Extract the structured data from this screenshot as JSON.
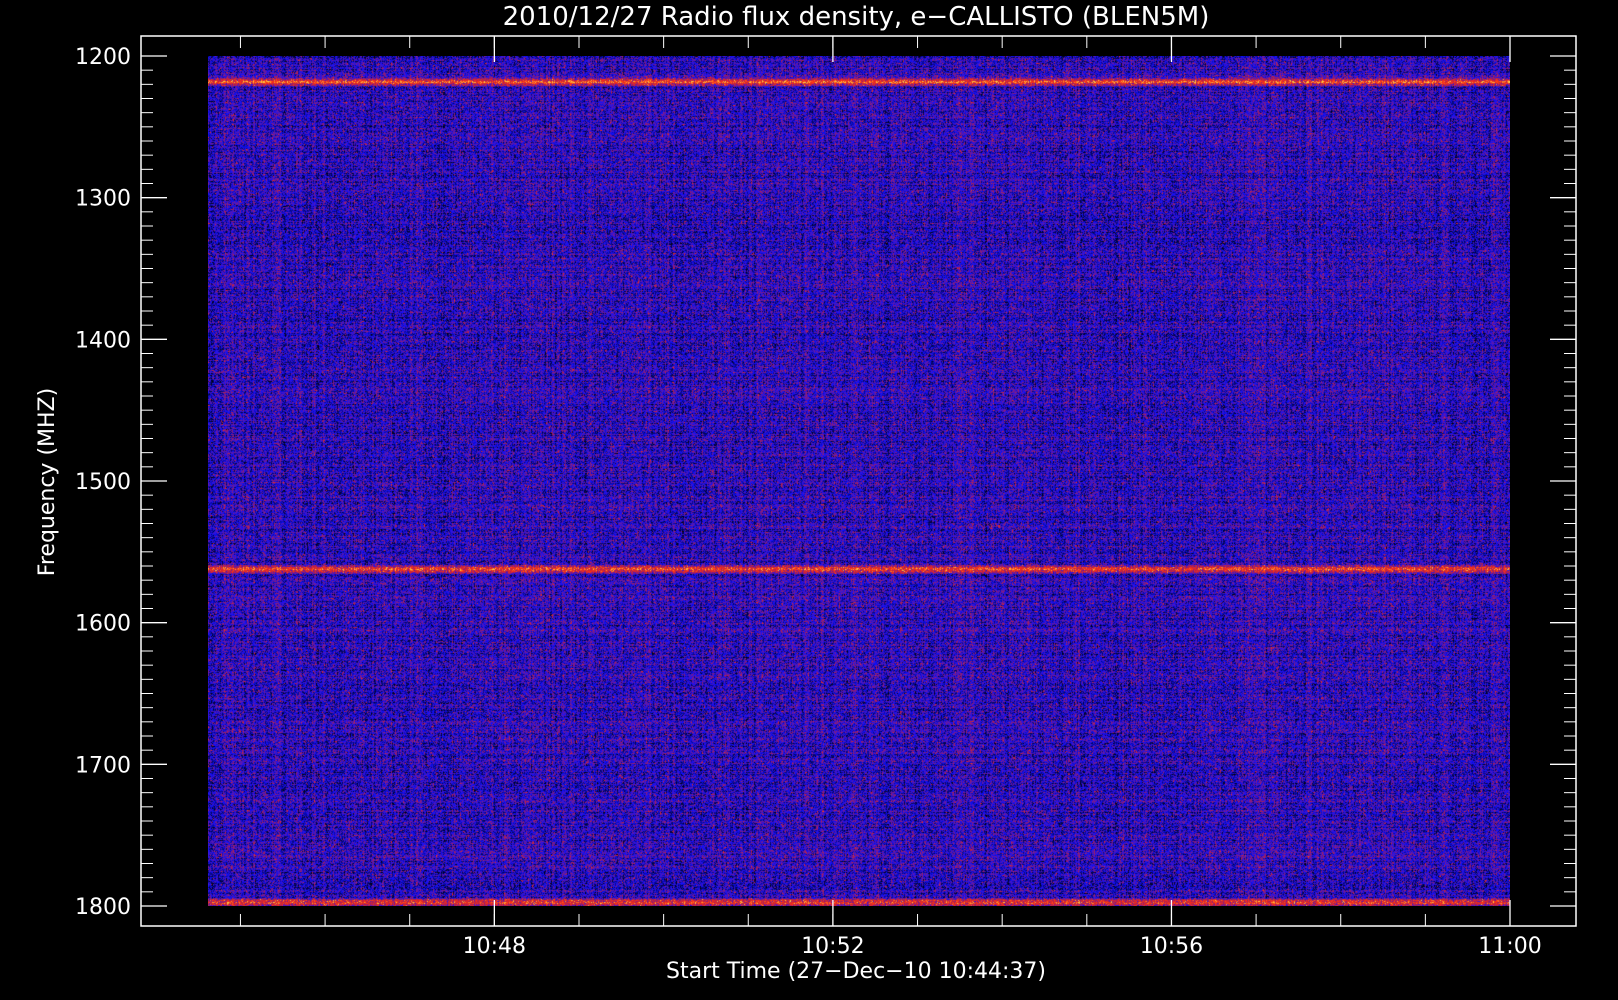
{
  "chart_data": {
    "type": "heatmap",
    "title": "2010/12/27  Radio flux density, e−CALLISTO (BLEN5M)",
    "xlabel": "Start Time (27−Dec−10 10:44:37)",
    "ylabel": "Frequency (MHZ)",
    "x_start": "10:44:37",
    "x_end": "11:00:00",
    "xlim": [
      "10:44:37",
      "11:00:00"
    ],
    "ylim": [
      1200,
      1800
    ],
    "y_inverted": true,
    "x_ticks": [
      {
        "value": "10:48",
        "label": "10:48"
      },
      {
        "value": "10:52",
        "label": "10:52"
      },
      {
        "value": "10:56",
        "label": "10:56"
      },
      {
        "value": "11:00",
        "label": "11:00"
      }
    ],
    "y_ticks": [
      {
        "value": 1200,
        "label": "1200"
      },
      {
        "value": 1300,
        "label": "1300"
      },
      {
        "value": 1400,
        "label": "1400"
      },
      {
        "value": 1500,
        "label": "1500"
      },
      {
        "value": 1600,
        "label": "1600"
      },
      {
        "value": 1700,
        "label": "1700"
      },
      {
        "value": 1800,
        "label": "1800"
      }
    ],
    "colormap": [
      "#000000",
      "#1010ff",
      "#b02050",
      "#ff3010",
      "#ffd040"
    ],
    "background_color": "#2a1ad0",
    "bright_bands": [
      {
        "frequency": 1218,
        "intensity": 0.95
      },
      {
        "frequency": 1562,
        "intensity": 0.9
      },
      {
        "frequency": 1797,
        "intensity": 0.8
      }
    ],
    "grid": false
  },
  "colors": {
    "page_background": "#000000",
    "axis": "#ffffff",
    "text": "#ffffff"
  }
}
